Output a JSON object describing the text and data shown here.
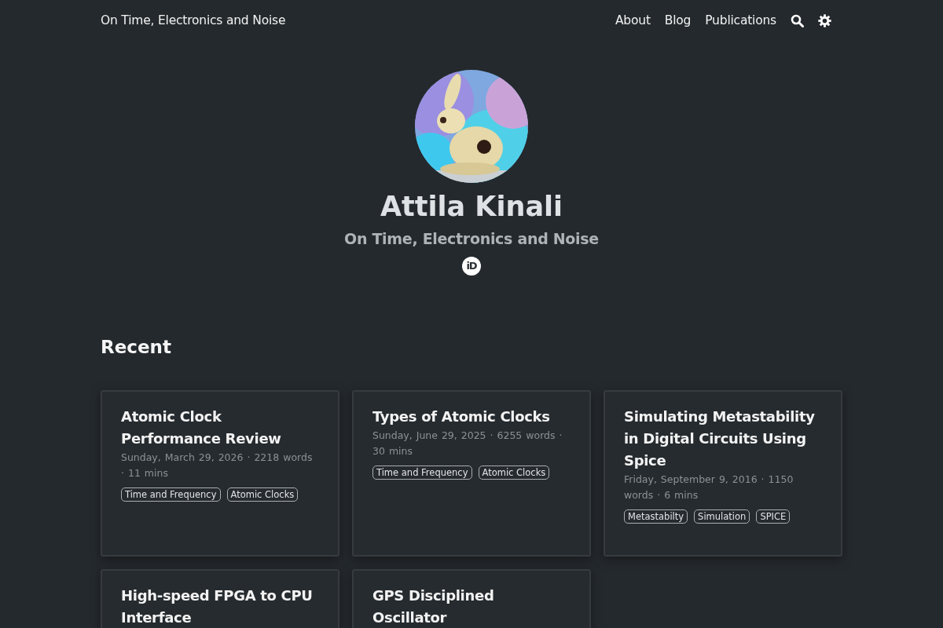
{
  "site_title": "On Time, Electronics and Noise",
  "nav": [
    {
      "label": "About",
      "kind": "link"
    },
    {
      "label": "Blog",
      "kind": "link"
    },
    {
      "label": "Publications",
      "kind": "link"
    },
    {
      "kind": "search"
    },
    {
      "kind": "theme"
    }
  ],
  "profile": {
    "name": "Attila Kinali",
    "subtitle": "On Time, Electronics and Noise",
    "orcid_label": "iD"
  },
  "section_title": "Recent",
  "posts": [
    {
      "title": "Atomic Clock Performance Review",
      "meta": "Sunday, March 29, 2026 · 2218 words · 11 mins",
      "tags": [
        "Time and Frequency",
        "Atomic Clocks"
      ]
    },
    {
      "title": "Types of Atomic Clocks",
      "meta": "Sunday, June 29, 2025 · 6255 words · 30 mins",
      "tags": [
        "Time and Frequency",
        "Atomic Clocks"
      ]
    },
    {
      "title": "Simulating Metastability in Digital Circuits Using Spice",
      "meta": "Friday, September 9, 2016 · 1150 words · 6 mins",
      "tags": [
        "Metastabilty",
        "Simulation",
        "SPICE"
      ]
    },
    {
      "title": "High-speed FPGA to CPU Interface"
    },
    {
      "title": "GPS Disciplined Oscillator"
    }
  ]
}
